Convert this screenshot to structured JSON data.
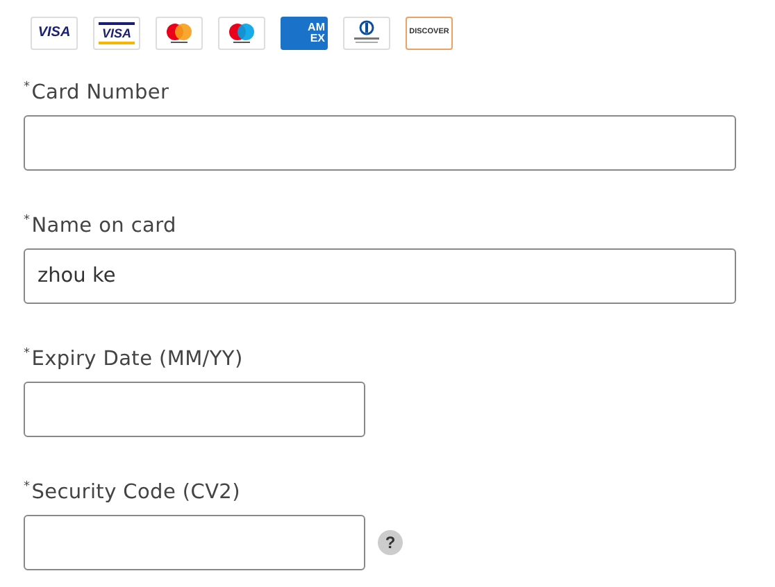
{
  "card_logos": [
    {
      "kind": "visa",
      "label": "VISA"
    },
    {
      "kind": "visa-electron",
      "label": "VISA"
    },
    {
      "kind": "mastercard"
    },
    {
      "kind": "maestro"
    },
    {
      "kind": "amex",
      "label": "AM EX"
    },
    {
      "kind": "diners"
    },
    {
      "kind": "discover",
      "label": "DISCOVER"
    }
  ],
  "fields": [
    {
      "label": "$^{*}$Card Number",
      "kind": "wide"
    },
    {
      "label": "$^{*}$Name on card",
      "value": "zhou ke",
      "kind": "wide"
    },
    {
      "label": "$^{*}$Expiry Date (MM/YY)",
      "kind": "narrow"
    },
    {
      "label": "$^{*}$Security Code (CV2)",
      "kind": "narrow",
      "help": "?"
    }
  ]
}
